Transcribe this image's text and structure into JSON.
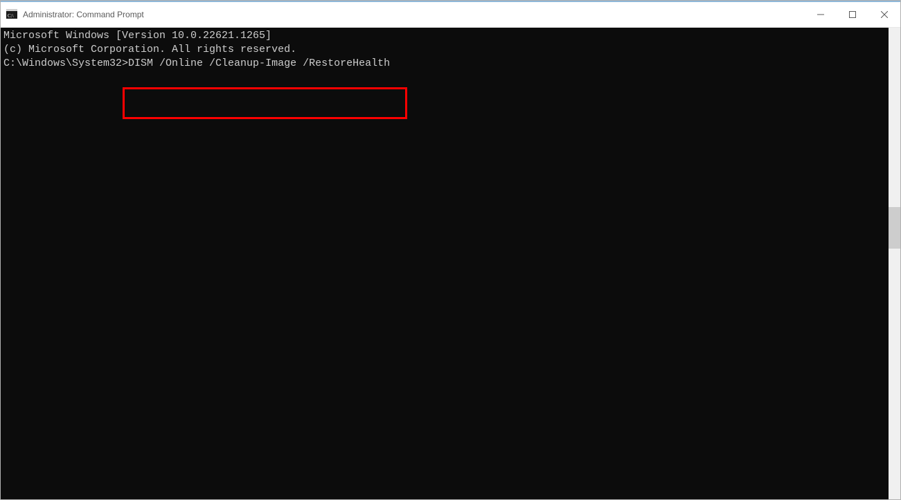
{
  "window": {
    "title": "Administrator: Command Prompt"
  },
  "terminal": {
    "line1": "Microsoft Windows [Version 10.0.22621.1265]",
    "line2": "(c) Microsoft Corporation. All rights reserved.",
    "blank": "",
    "prompt_path": "C:\\Windows\\System32>",
    "command": "DISM /Online /Cleanup-Image /RestoreHealth"
  }
}
